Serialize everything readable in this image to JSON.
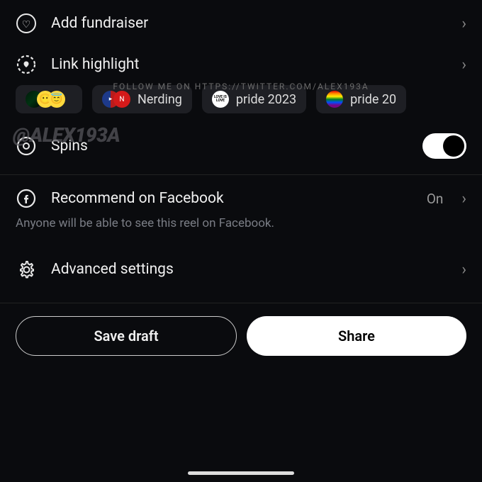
{
  "fundraiser": {
    "label": "Add fundraiser"
  },
  "linkHighlight": {
    "label": "Link highlight"
  },
  "watermarkTop": "FOLLOW ME ON HTTPS://TWITTER.COM/ALEX193A",
  "watermarkHandle": "@ALEX193A",
  "chips": [
    {
      "label": ""
    },
    {
      "label": "Nerding"
    },
    {
      "label": "pride 2023",
      "avatarText": "LOVE IS LOVE"
    },
    {
      "label": "pride 20"
    }
  ],
  "spins": {
    "label": "Spins",
    "on": true
  },
  "facebook": {
    "label": "Recommend on Facebook",
    "value": "On",
    "subtitle": "Anyone will be able to see this reel on Facebook."
  },
  "advanced": {
    "label": "Advanced settings"
  },
  "buttons": {
    "saveDraft": "Save draft",
    "share": "Share"
  }
}
